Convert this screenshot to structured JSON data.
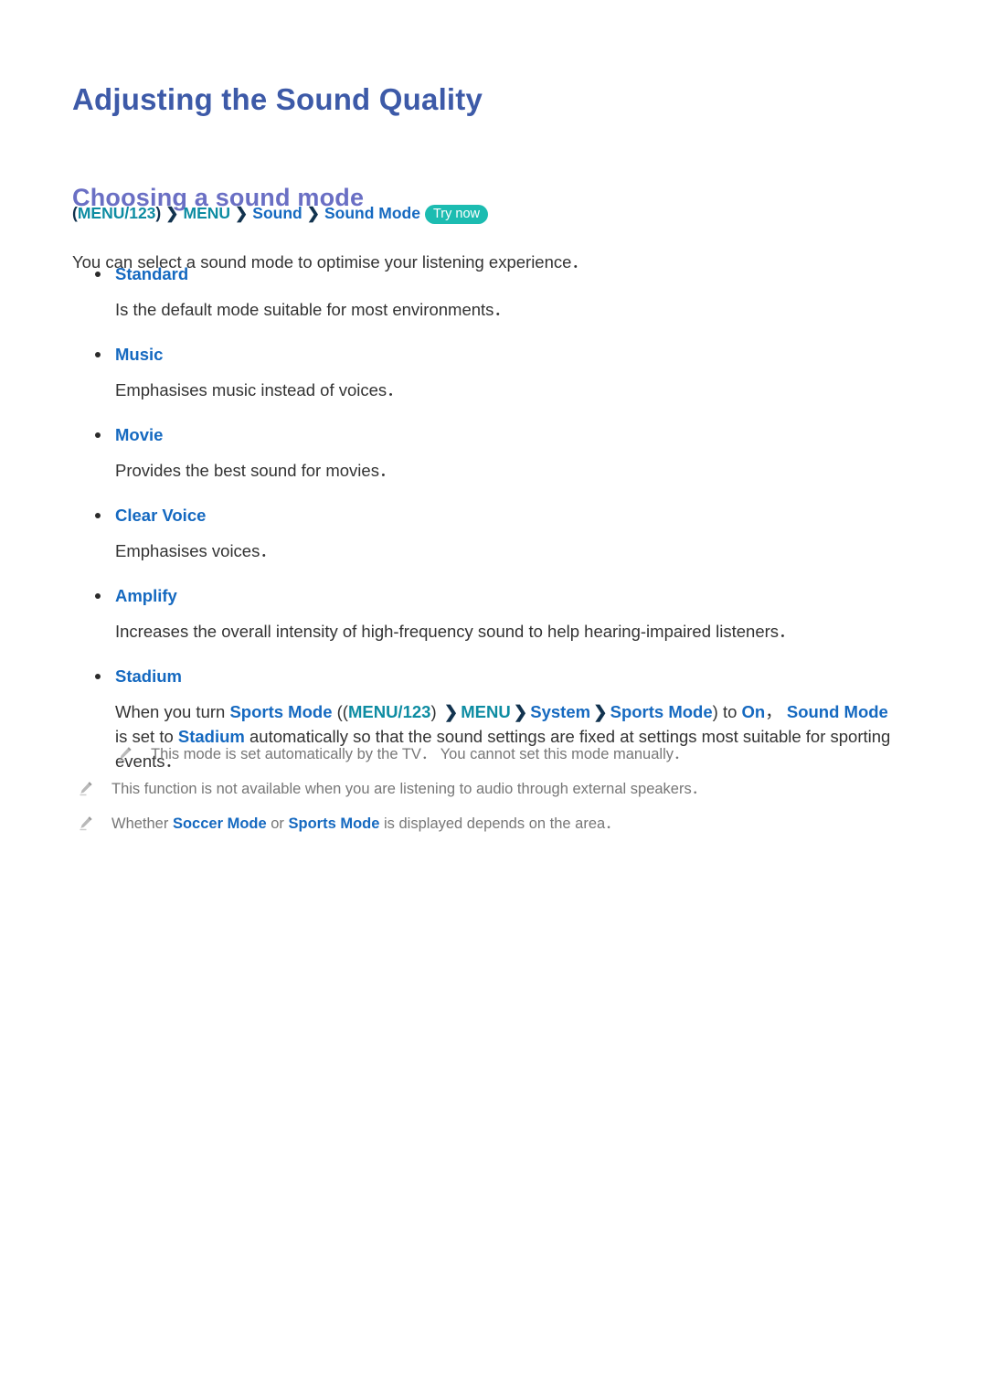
{
  "document": {
    "title": "Adjusting the Sound Quality",
    "section_title": "Choosing a sound mode"
  },
  "breadcrumb": {
    "open_paren": "(",
    "menu123": "MENU/123",
    "close_paren": ")",
    "arrow": "❯",
    "menu": "MENU",
    "sound": "Sound",
    "sound_mode": "Sound Mode",
    "try_now": "Try now"
  },
  "intro": "You can select a sound mode to optimise your listening experience．",
  "sound_modes": [
    {
      "label": "Standard",
      "description": "Is the default mode suitable for most environments．"
    },
    {
      "label": "Music",
      "description": "Emphasises music instead of voices．"
    },
    {
      "label": "Movie",
      "description": "Provides the best sound for movies．"
    },
    {
      "label": "Clear Voice",
      "description": "Emphasises voices．"
    },
    {
      "label": "Amplify",
      "description": "Increases the overall intensity of high-frequency sound to help hearing-impaired listeners．"
    },
    {
      "label": "Stadium",
      "description_parts": {
        "t1": "When you turn ",
        "sports_mode_1": "Sports Mode",
        "t2": " ((",
        "menu123": "MENU/123",
        "t3": ") ",
        "arrow": "❯",
        "menu": "MENU",
        "system": "System",
        "sports_mode_2": "Sports Mode",
        "t4": ") to ",
        "on": "On",
        "t5": "， ",
        "sound_mode": "Sound Mode",
        "t6": " is set to ",
        "stadium": "Stadium",
        "t7": " automatically so that the sound settings are fixed at settings most suitable for sporting events．"
      }
    }
  ],
  "notes": [
    {
      "icon": "pencil-icon",
      "indented": true,
      "text": "This mode is set automatically by the TV． You cannot set this mode manually．"
    },
    {
      "icon": "pencil-icon",
      "indented": false,
      "text": "This function is not available when you are listening to audio through external speakers．"
    },
    {
      "icon": "pencil-icon",
      "indented": false,
      "parts": {
        "t1": "Whether ",
        "soccer_mode": "Soccer Mode",
        "t2": " or ",
        "sports_mode": "Sports Mode",
        "t3": " is displayed depends on the area．"
      }
    }
  ],
  "colors": {
    "title": "#3d5aa8",
    "section_title": "#6a6fc4",
    "link_blue": "#1569c0",
    "link_teal": "#0d8ca2",
    "arrow_navy": "#12334f",
    "badge_teal": "#1cbcb1",
    "body_text": "#333333",
    "note_text": "#777777"
  }
}
